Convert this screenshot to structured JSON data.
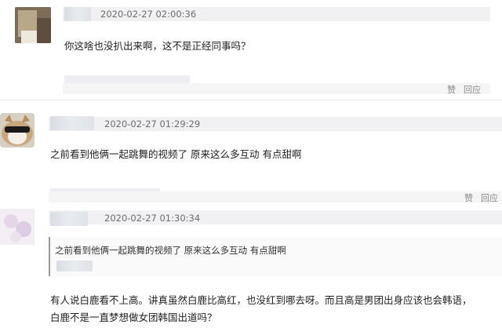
{
  "comments": [
    {
      "timestamp": "2020-02-27 02:00:36",
      "text": "你这啥也没扒出来啊，这不是正经同事吗？",
      "actions": {
        "like": "赞",
        "reply": "回应"
      }
    },
    {
      "timestamp": "2020-02-27 01:29:29",
      "text": "之前看到他俩一起跳舞的视频了 原来这么多互动 有点甜啊",
      "actions": {
        "like": "赞",
        "reply": "回应"
      }
    },
    {
      "timestamp": "2020-02-27 01:30:34",
      "quote": "之前看到他俩一起跳舞的视频了 原来这么多互动 有点甜啊",
      "text_line1": "有人说白鹿看不上高。讲真虽然白鹿比高红，也没红到哪去呀。而且高是男团出身应该也会韩语，",
      "text_line2": "白鹿不是一直梦想做女团韩国出道吗？"
    }
  ]
}
